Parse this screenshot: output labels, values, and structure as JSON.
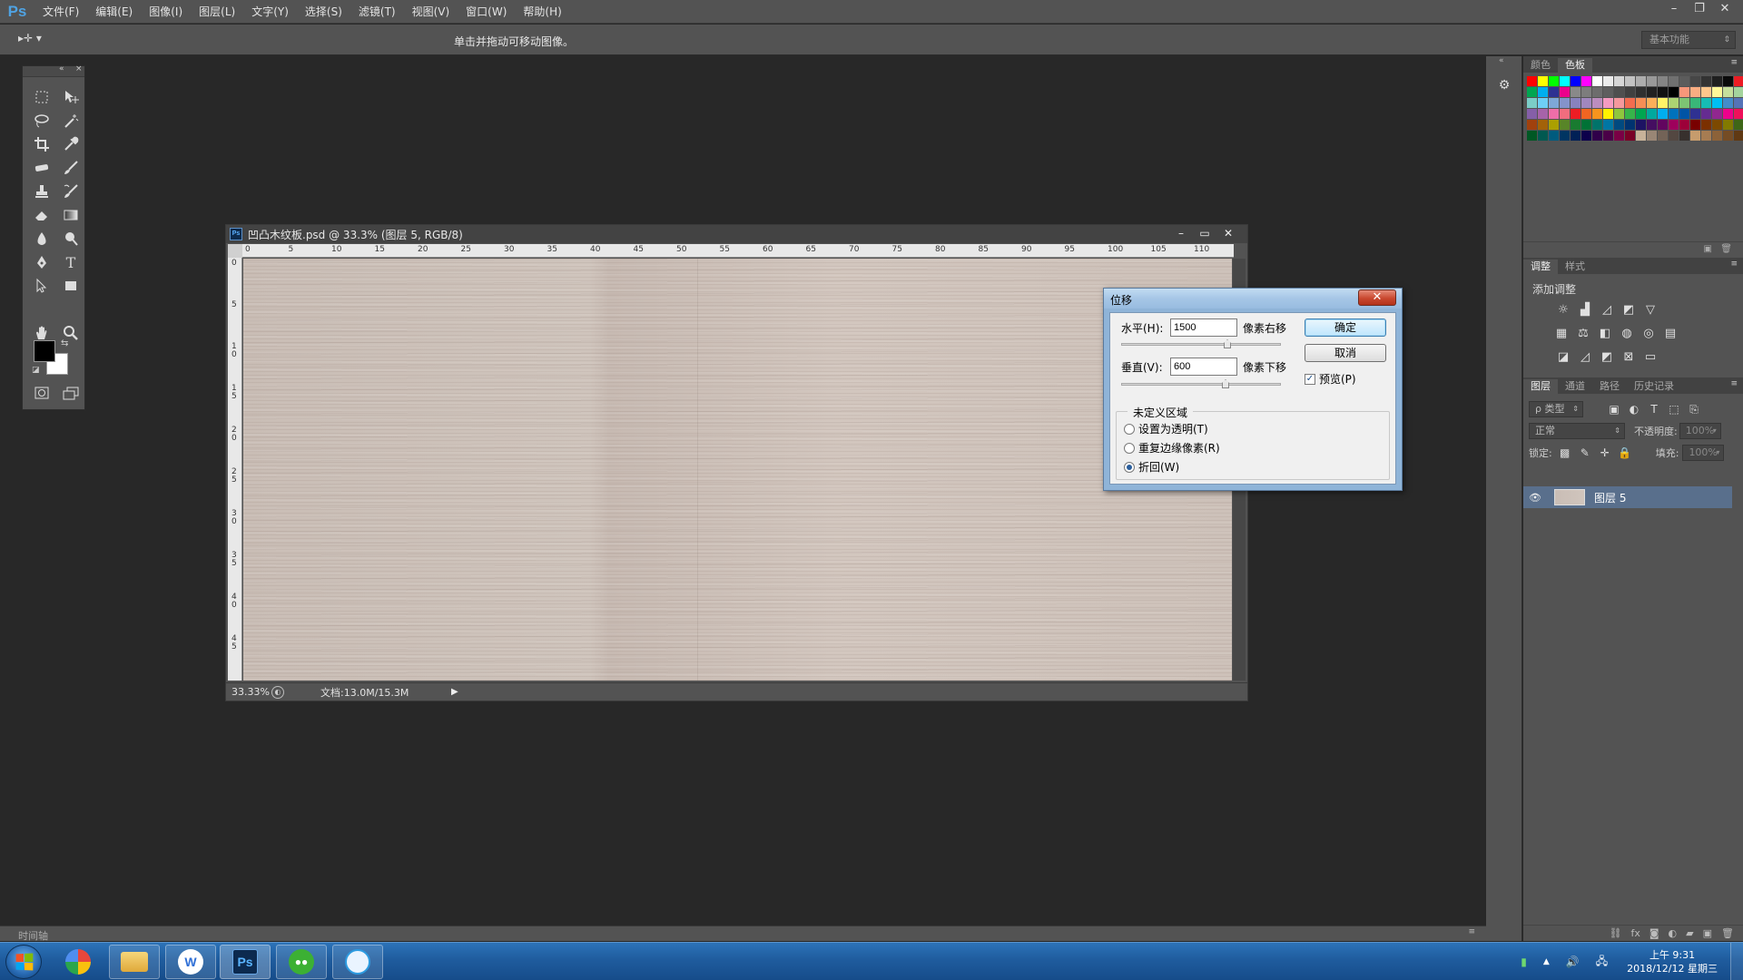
{
  "app": {
    "logo": "Ps"
  },
  "menu": [
    "文件(F)",
    "编辑(E)",
    "图像(I)",
    "图层(L)",
    "文字(Y)",
    "选择(S)",
    "滤镜(T)",
    "视图(V)",
    "窗口(W)",
    "帮助(H)"
  ],
  "window_controls": {
    "minimize": "–",
    "restore": "❐",
    "close": "✕"
  },
  "options": {
    "tool_symbol": "▸✛ ▾",
    "hint": "单击并拖动可移动图像。",
    "workspace": "基本功能"
  },
  "document": {
    "title": "凹凸木纹板.psd @ 33.3% (图层 5, RGB/8)",
    "zoom": "33.33%",
    "info": "文档:13.0M/15.3M",
    "ruler_top": [
      "0",
      "5",
      "10",
      "15",
      "20",
      "25",
      "30",
      "35",
      "40",
      "45",
      "50",
      "55",
      "60",
      "65",
      "70",
      "75",
      "80",
      "85",
      "90",
      "95",
      "100",
      "105",
      "110"
    ],
    "ruler_left": [
      "0",
      "5",
      "10",
      "15",
      "20",
      "25",
      "30",
      "35",
      "40",
      "45"
    ]
  },
  "dialog": {
    "title": "位移",
    "close": "✕",
    "horizontal_label": "水平(H):",
    "horizontal_value": "1500",
    "horizontal_unit": "像素右移",
    "vertical_label": "垂直(V):",
    "vertical_value": "600",
    "vertical_unit": "像素下移",
    "ok": "确定",
    "cancel": "取消",
    "preview_label": "预览(P)",
    "preview_checked": true,
    "group_title": "未定义区域",
    "options": [
      "设置为透明(T)",
      "重复边缘像素(R)",
      "折回(W)"
    ],
    "selected_option": 2
  },
  "panels": {
    "color_tabs": [
      "颜色",
      "色板"
    ],
    "adjust_tabs": [
      "调整",
      "样式"
    ],
    "adjust_title": "添加调整",
    "layer_tabs": [
      "图层",
      "通道",
      "路径",
      "历史记录"
    ],
    "filter_kind": "ρ 类型",
    "blend_mode": "正常",
    "opacity_label": "不透明度:",
    "opacity_value": "100%",
    "lock_label": "锁定:",
    "fill_label": "填充:",
    "fill_value": "100%",
    "layer_name": "图层 5"
  },
  "swatch_colors": [
    "#ff0000",
    "#ffff00",
    "#00ff00",
    "#00ffff",
    "#0000ff",
    "#ff00ff",
    "#ffffff",
    "#ebebeb",
    "#d6d6d6",
    "#c2c2c2",
    "#adadad",
    "#999999",
    "#858585",
    "#707070",
    "#5c5c5c",
    "#474747",
    "#333333",
    "#1f1f1f",
    "#0a0a0a",
    "#ed1c24",
    "#fff200",
    "#00a651",
    "#00aeef",
    "#2e3192",
    "#ec008c",
    "#898989",
    "#7d7d7d",
    "#6d6d6d",
    "#5e5e5e",
    "#4f4f4f",
    "#404040",
    "#303030",
    "#212121",
    "#121212",
    "#000000",
    "#f7977a",
    "#fbad82",
    "#fdc68c",
    "#fff799",
    "#c6df9c",
    "#a4d49d",
    "#81ca9d",
    "#7bcdc8",
    "#6ecff6",
    "#7ea7d8",
    "#8493ca",
    "#8882be",
    "#a187be",
    "#bc8dbf",
    "#f49bc1",
    "#f5989d",
    "#f26c4f",
    "#f68e55",
    "#fbaf5a",
    "#fff467",
    "#acd372",
    "#7dc473",
    "#39b778",
    "#16bcb4",
    "#00bff3",
    "#438ccb",
    "#5573b7",
    "#5e5ca7",
    "#855fa8",
    "#a763a9",
    "#ef6ea8",
    "#f16d7e",
    "#ee1d24",
    "#f16522",
    "#f7941d",
    "#fff100",
    "#8fc63d",
    "#37b44a",
    "#00a650",
    "#00a99e",
    "#00aeef",
    "#0072bc",
    "#0054a5",
    "#2f3192",
    "#652c91",
    "#91278f",
    "#ed008c",
    "#ee105a",
    "#9d0a0f",
    "#a1410d",
    "#a36209",
    "#aba000",
    "#588528",
    "#197b30",
    "#007236",
    "#00736a",
    "#0076a4",
    "#004a80",
    "#003370",
    "#1d1363",
    "#450e61",
    "#62055f",
    "#9e005c",
    "#9d0039",
    "#790000",
    "#7b3000",
    "#7c4900",
    "#827a00",
    "#3e6617",
    "#045f20",
    "#005824",
    "#005951",
    "#005b7e",
    "#003562",
    "#002056",
    "#0c004b",
    "#30004a",
    "#4b0048",
    "#7a0045",
    "#7a0026",
    "#c7b299",
    "#998675",
    "#736357",
    "#534741",
    "#37302d",
    "#c69c6d",
    "#a67c52",
    "#8c6239",
    "#754c24",
    "#603913"
  ],
  "timeline": {
    "label": "时间轴"
  },
  "taskbar": {
    "clock_time": "上午 9:31",
    "clock_date": "2018/12/12 星期三",
    "tray_up": "▲"
  }
}
